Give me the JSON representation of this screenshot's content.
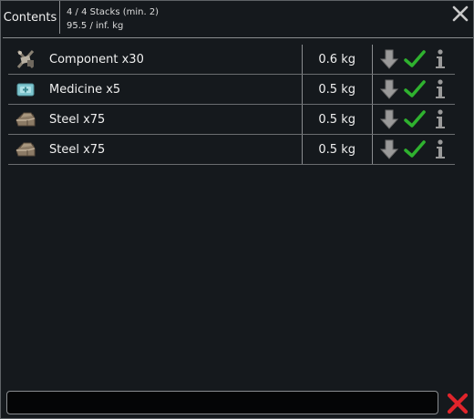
{
  "tab": {
    "label": "Contents"
  },
  "stats": {
    "stacks": "4 / 4 Stacks (min. 2)",
    "mass": "95.5 / inf. kg"
  },
  "items": [
    {
      "label": "Component x30",
      "mass": "0.6 kg",
      "icon": "component-icon"
    },
    {
      "label": "Medicine x5",
      "mass": "0.5 kg",
      "icon": "medicine-icon"
    },
    {
      "label": "Steel x75",
      "mass": "0.5 kg",
      "icon": "steel-icon"
    },
    {
      "label": "Steel x75",
      "mass": "0.5 kg",
      "icon": "steel-icon"
    }
  ],
  "search": {
    "value": "",
    "placeholder": ""
  },
  "colors": {
    "background": "#15191d",
    "check_green": "#2fb22f",
    "clear_red": "#e0242b",
    "icon_gray": "#9a9a9a"
  }
}
